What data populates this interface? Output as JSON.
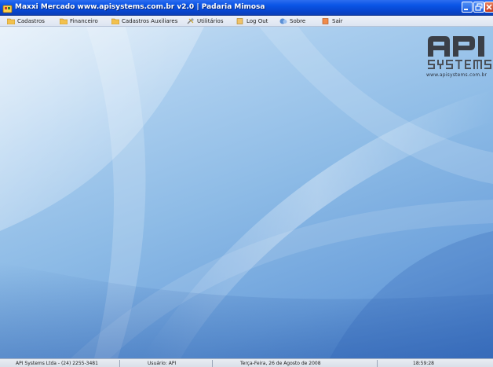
{
  "window": {
    "title": "Maxxi Mercado www.apisystems.com.br v2.0 | Padaria Mimosa"
  },
  "menu": {
    "items": [
      {
        "label": "Cadastros",
        "icon": "folder-icon"
      },
      {
        "label": "Financeiro",
        "icon": "folder-icon"
      },
      {
        "label": "Cadastros Auxiliares",
        "icon": "folder-icon"
      },
      {
        "label": "Utilitários",
        "icon": "tools-icon"
      },
      {
        "label": "Log Out",
        "icon": "logout-icon"
      },
      {
        "label": "Sobre",
        "icon": "info-icon"
      },
      {
        "label": "Sair",
        "icon": "exit-icon"
      }
    ]
  },
  "logo": {
    "text": "API SYSTEMS",
    "url": "www.apisystems.com.br"
  },
  "status": {
    "company": "API Systems Ltda - (24) 2255-3481",
    "user": "Usuário: API",
    "date": "Terça-Feira, 26 de Agosto de 2008",
    "time": "18:59:28"
  },
  "colors": {
    "titlebar": "#0a55e6",
    "desktop_light": "#cfe3f5",
    "desktop_dark": "#4a7fc9"
  }
}
